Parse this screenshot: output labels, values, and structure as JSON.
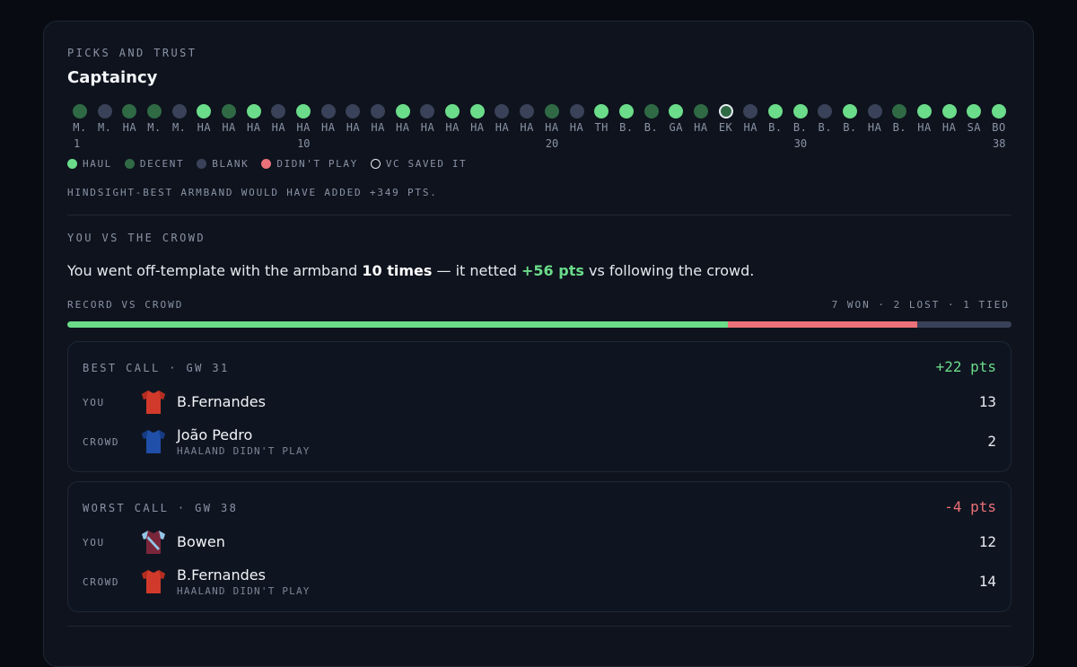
{
  "colors": {
    "haul": "#6bdc8a",
    "decent": "#2f6a45",
    "blank": "#394258",
    "didnt_play": "#ec7178",
    "positive": "#6bdc8a",
    "negative": "#ec7178",
    "tied": "#394258"
  },
  "captaincy": {
    "eyebrow": "PICKS AND TRUST",
    "title": "Captaincy",
    "gameweeks": [
      {
        "gw": 1,
        "label": "M.",
        "result": "decent"
      },
      {
        "gw": 2,
        "label": "M.",
        "result": "blank"
      },
      {
        "gw": 3,
        "label": "HA",
        "result": "decent"
      },
      {
        "gw": 4,
        "label": "M.",
        "result": "decent"
      },
      {
        "gw": 5,
        "label": "M.",
        "result": "blank"
      },
      {
        "gw": 6,
        "label": "HA",
        "result": "haul"
      },
      {
        "gw": 7,
        "label": "HA",
        "result": "decent"
      },
      {
        "gw": 8,
        "label": "HA",
        "result": "haul"
      },
      {
        "gw": 9,
        "label": "HA",
        "result": "blank"
      },
      {
        "gw": 10,
        "label": "HA",
        "result": "haul"
      },
      {
        "gw": 11,
        "label": "HA",
        "result": "blank"
      },
      {
        "gw": 12,
        "label": "HA",
        "result": "blank"
      },
      {
        "gw": 13,
        "label": "HA",
        "result": "blank"
      },
      {
        "gw": 14,
        "label": "HA",
        "result": "haul"
      },
      {
        "gw": 15,
        "label": "HA",
        "result": "blank"
      },
      {
        "gw": 16,
        "label": "HA",
        "result": "haul"
      },
      {
        "gw": 17,
        "label": "HA",
        "result": "haul"
      },
      {
        "gw": 18,
        "label": "HA",
        "result": "blank"
      },
      {
        "gw": 19,
        "label": "HA",
        "result": "blank"
      },
      {
        "gw": 20,
        "label": "HA",
        "result": "decent"
      },
      {
        "gw": 21,
        "label": "HA",
        "result": "blank"
      },
      {
        "gw": 22,
        "label": "TH",
        "result": "haul"
      },
      {
        "gw": 23,
        "label": "B.",
        "result": "haul"
      },
      {
        "gw": 24,
        "label": "B.",
        "result": "decent"
      },
      {
        "gw": 25,
        "label": "GA",
        "result": "haul"
      },
      {
        "gw": 26,
        "label": "HA",
        "result": "decent"
      },
      {
        "gw": 27,
        "label": "EK",
        "result": "vc_saved"
      },
      {
        "gw": 28,
        "label": "HA",
        "result": "blank"
      },
      {
        "gw": 29,
        "label": "B.",
        "result": "haul"
      },
      {
        "gw": 30,
        "label": "B.",
        "result": "haul"
      },
      {
        "gw": 31,
        "label": "B.",
        "result": "blank"
      },
      {
        "gw": 32,
        "label": "B.",
        "result": "haul"
      },
      {
        "gw": 33,
        "label": "HA",
        "result": "blank"
      },
      {
        "gw": 34,
        "label": "B.",
        "result": "decent"
      },
      {
        "gw": 35,
        "label": "HA",
        "result": "haul"
      },
      {
        "gw": 36,
        "label": "HA",
        "result": "haul"
      },
      {
        "gw": 37,
        "label": "SA",
        "result": "haul"
      },
      {
        "gw": 38,
        "label": "BO",
        "result": "haul"
      }
    ],
    "axis_numbers": [
      "1",
      "10",
      "20",
      "30",
      "38"
    ],
    "legend": [
      {
        "key": "haul",
        "label": "HAUL"
      },
      {
        "key": "decent",
        "label": "DECENT"
      },
      {
        "key": "blank",
        "label": "BLANK"
      },
      {
        "key": "didnt_play",
        "label": "DIDN'T PLAY"
      },
      {
        "key": "vc_saved",
        "label": "VC SAVED IT"
      }
    ],
    "hindsight_note": "HINDSIGHT-BEST ARMBAND WOULD HAVE ADDED +349 PTS."
  },
  "crowd": {
    "eyebrow": "YOU VS THE CROWD",
    "sentence": {
      "part1": "You went off-template with the armband ",
      "times": "10 times",
      "part2": " — it netted ",
      "pts": "+56 pts",
      "part3": " vs following the crowd."
    },
    "record_label": "RECORD VS CROWD",
    "record_summary": "7 WON · 2 LOST · 1 TIED",
    "record": {
      "won": 7,
      "lost": 2,
      "tied": 1
    },
    "best_call": {
      "title": "BEST CALL · GW 31",
      "delta": "+22 pts",
      "you": {
        "tag": "YOU",
        "name": "B.Fernandes",
        "note": "",
        "score": "13",
        "kit": "red"
      },
      "crowd": {
        "tag": "CROWD",
        "name": "João Pedro",
        "note": "HAALAND DIDN'T PLAY",
        "score": "2",
        "kit": "blue"
      }
    },
    "worst_call": {
      "title": "WORST CALL · GW 38",
      "delta": "-4 pts",
      "you": {
        "tag": "YOU",
        "name": "Bowen",
        "note": "",
        "score": "12",
        "kit": "claret"
      },
      "crowd": {
        "tag": "CROWD",
        "name": "B.Fernandes",
        "note": "HAALAND DIDN'T PLAY",
        "score": "14",
        "kit": "red"
      }
    }
  }
}
